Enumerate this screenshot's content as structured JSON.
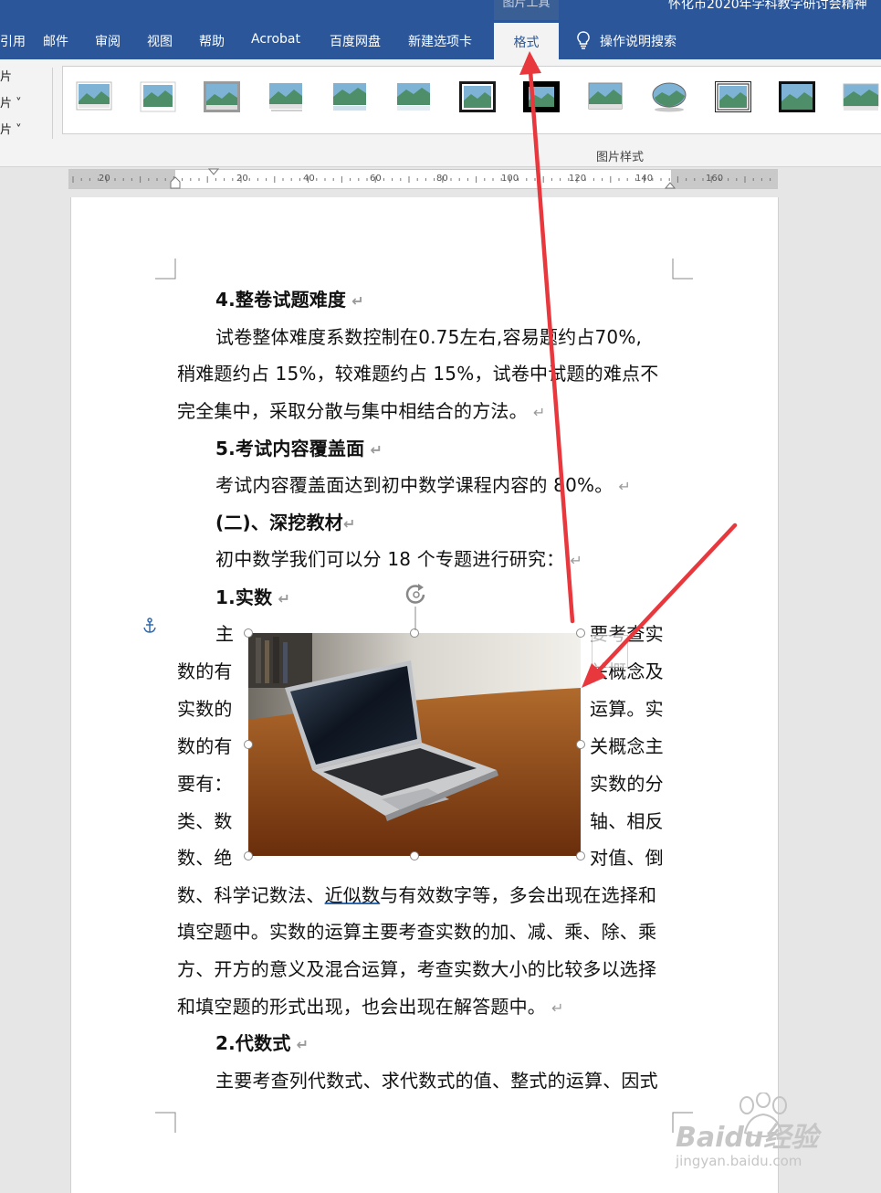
{
  "ribbon": {
    "context_group": "图片工具",
    "doc_title": "怀化市2020年学科教学研讨会精神",
    "tabs": [
      "引用",
      "邮件",
      "审阅",
      "视图",
      "帮助",
      "Acrobat",
      "百度网盘",
      "新建选项卡"
    ],
    "active_tab": "格式",
    "tell_me": "操作说明搜索",
    "left_commands": [
      "片",
      "片 ˅",
      "片 ˅"
    ],
    "group_label": "图片样式"
  },
  "ruler": {
    "labels": [
      "20",
      "20",
      "40",
      "60",
      "80",
      "100",
      "120",
      "140",
      "160"
    ]
  },
  "document": {
    "h4": "4.整卷试题难度",
    "p1": [
      "试卷整体难度系数控制在0.75左右,容易题约占70%,",
      "稍难题约占 15%，较难题约占 15%，试卷中试题的难点不",
      "完全集中，采取分散与集中相结合的方法。"
    ],
    "h5": "5.考试内容覆盖面",
    "p2": "考试内容覆盖面达到初中数学课程内容的 80%。",
    "h_sec": "(二)、深挖教材",
    "p3": "初中数学我们可以分 18 个专题进行研究：",
    "h1": "1.实数",
    "wrap_left": [
      "主",
      "数的有",
      "实数的",
      "数的有",
      "要有：",
      "类、数",
      "数、绝"
    ],
    "wrap_right": [
      "要考查实",
      "关概念及",
      "运算。实",
      "关概念主",
      "实数的分",
      "轴、相反",
      "对值、倒"
    ],
    "p4_pre": "数、科学记数法、",
    "p4_link": "近似数",
    "p4_post": "与有效数字等，多会出现在选择和",
    "p4": [
      "填空题中。实数的运算主要考查实数的加、减、乘、除、乘",
      "方、开方的意义及混合运算，考查实数大小的比较多以选择",
      "和填空题的形式出现，也会出现在解答题中。"
    ],
    "h2": "2.代数式",
    "p5": "主要考查列代数式、求代数式的值、整式的运算、因式"
  },
  "paragraph_mark": "↵",
  "watermark": {
    "brand": "Baidu经验",
    "url": "jingyan.baidu.com"
  },
  "colors": {
    "ribbon_blue": "#2b579a",
    "arrow_red": "#e8383d"
  }
}
